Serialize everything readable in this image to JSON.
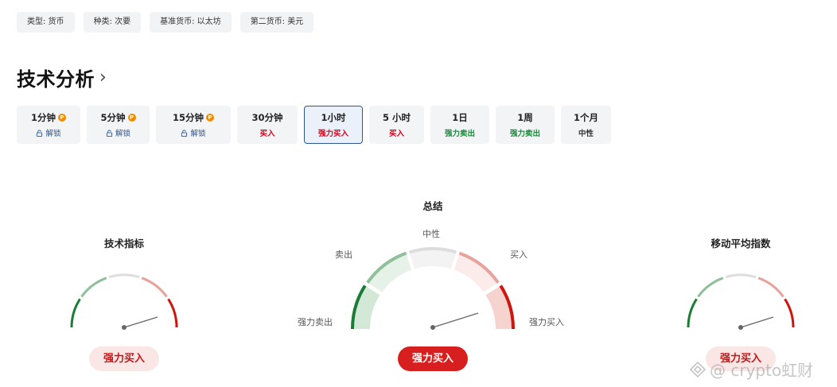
{
  "info_chips": [
    {
      "label": "类型: 货币"
    },
    {
      "label": "种类: 次要"
    },
    {
      "label": "基准货币: 以太坊"
    },
    {
      "label": "第二货币: 美元"
    }
  ],
  "section": {
    "title": "技术分析",
    "chevron": "›"
  },
  "timeframes": [
    {
      "label": "1分钟",
      "signal": "解锁",
      "pro": "P",
      "locked": true
    },
    {
      "label": "5分钟",
      "signal": "解锁",
      "pro": "P",
      "locked": true
    },
    {
      "label": "15分钟",
      "signal": "解锁",
      "pro": "P",
      "locked": true
    },
    {
      "label": "30分钟",
      "signal": "买入"
    },
    {
      "label": "1小时",
      "signal": "强力买入",
      "active": true
    },
    {
      "label": "5 小时",
      "signal": "买入"
    },
    {
      "label": "1日",
      "signal": "强力卖出"
    },
    {
      "label": "1周",
      "signal": "强力卖出"
    },
    {
      "label": "1个月",
      "signal": "中性"
    }
  ],
  "gauges": {
    "left": {
      "title": "技术指标",
      "result": "强力买入"
    },
    "center": {
      "title": "总结",
      "result": "强力买入",
      "labels": {
        "strong_sell": "强力卖出",
        "sell": "卖出",
        "neutral": "中性",
        "buy": "买入",
        "strong_buy": "强力买入"
      }
    },
    "right": {
      "title": "移动平均指数",
      "result": "强力买入"
    }
  },
  "watermark": {
    "text": "@ crypto虹财"
  },
  "colors": {
    "strong_sell": "#1b7d35",
    "sell": "#8fbf9b",
    "neutral": "#dddddd",
    "buy": "#e8a19b",
    "strong_buy": "#d0140f",
    "active_border": "#2b5797"
  }
}
